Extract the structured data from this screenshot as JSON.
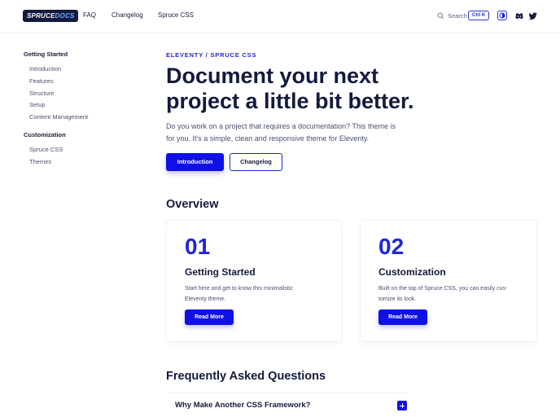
{
  "header": {
    "logo": {
      "part1": "SPRUCE",
      "part2": "DOCS"
    },
    "nav": [
      "FAQ",
      "Changelog",
      "Spruce CSS"
    ],
    "nav_chevron": "›",
    "search_label": "Search",
    "search_shortcut": "Ctrl K",
    "icons": [
      "theme-toggle-icon",
      "github-icon",
      "twitter-icon"
    ]
  },
  "sidebar": {
    "groups": [
      {
        "title": "Getting Started",
        "items": [
          "Introduction",
          "Features",
          "Structure",
          "Setup",
          "Content Management"
        ]
      },
      {
        "title": "Customization",
        "items": [
          "Spruce CSS",
          "Themes"
        ]
      }
    ]
  },
  "hero": {
    "eyebrow": "ELEVENTY / SPRUCE CSS",
    "title_line1": "Document your next",
    "title_line2": "project a little bit better.",
    "desc_line1": "Do you work on a project that requires a documentation? This theme is",
    "desc_line2": "for you. It's a simple, clean and responsive theme for Eleventy.",
    "primary_button": "Introduction",
    "secondary_button": "Changelog"
  },
  "overview": {
    "title": "Overview",
    "cards": [
      {
        "number": "01",
        "title": "Getting Started",
        "desc_line1": "Start here and get to know this minimalistic",
        "desc_line2": "Eleventy theme.",
        "button": "Read More"
      },
      {
        "number": "02",
        "title": "Customization",
        "desc_line1": "Built on the top of Spruce CSS, you can easily cus-",
        "desc_line2": "tomize its look.",
        "button": "Read More"
      }
    ]
  },
  "faq": {
    "title": "Frequently Asked Questions",
    "items": [
      "Why Make Another CSS Framework?"
    ]
  },
  "colors": {
    "accent": "#0f0fe6",
    "heading": "#141a3d",
    "text": "#4a5070",
    "logo_bg": "#141a3d",
    "logo_accent": "#63b3ff"
  }
}
